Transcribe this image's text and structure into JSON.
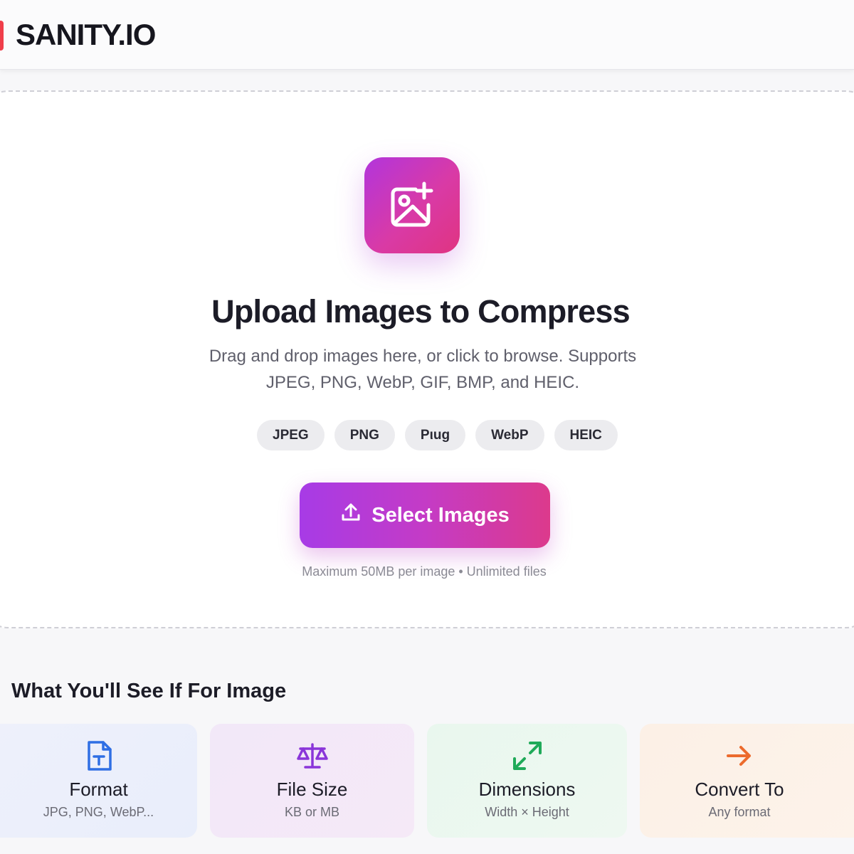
{
  "header": {
    "logo_text": "SANITY.IO"
  },
  "upload": {
    "title": "Upload Images to Compress",
    "description": "Drag and drop images here, or click to browse. Supports JPEG, PNG, WebP, GIF, BMP, and HEIC.",
    "format_chips": [
      "JPEG",
      "PNG",
      "Pιug",
      "WebP",
      "HEIC"
    ],
    "select_button_label": "Select Images",
    "limits_text": "Maximum 50MB per image • Unlimited files",
    "icon": "image-add-icon",
    "button_icon": "upload-icon"
  },
  "features": {
    "title": "What You'll See If For Image",
    "cards": [
      {
        "title": "Format",
        "subtitle": "JPG, PNG, WebP...",
        "icon": "file-type-icon"
      },
      {
        "title": "File Size",
        "subtitle": "KB or MB",
        "icon": "scale-icon"
      },
      {
        "title": "Dimensions",
        "subtitle": "Width × Height",
        "icon": "expand-arrows-icon"
      },
      {
        "title": "Convert To",
        "subtitle": "Any format",
        "icon": "arrow-right-icon"
      }
    ]
  },
  "colors": {
    "brand_red": "#f03e4a",
    "gradient_start": "#a73be6",
    "gradient_end": "#dc3a8c",
    "format_icon": "#2f6fe4",
    "size_icon": "#8a35d9",
    "dimensions_icon": "#1faa59",
    "convert_icon": "#ec6b2d"
  }
}
